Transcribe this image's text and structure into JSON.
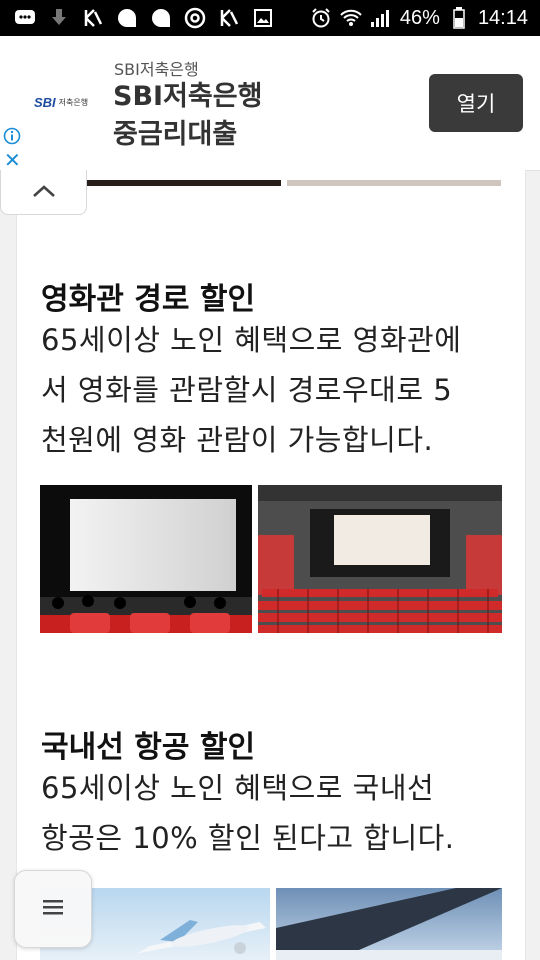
{
  "status_bar": {
    "battery": "46%",
    "time": "14:14"
  },
  "ad": {
    "logo_text": "SBI",
    "logo_sub": "저축은행",
    "subtitle": "SBI저축은행",
    "title_line1": "SBI저축은행",
    "title_line2": "중금리대출",
    "button": "열기"
  },
  "sections": [
    {
      "heading": "영화관 경로 할인",
      "lines": [
        "65세이상 노인 혜택으로 영화관에",
        "서 영화를 관람할시 경로우대로 5",
        "천원에 영화 관람이 가능합니다."
      ]
    },
    {
      "heading": "국내선 항공 할인",
      "lines": [
        "65세이상 노인 혜택으로 국내선",
        "항공은 10% 할인 된다고 합니다."
      ]
    }
  ],
  "icons": {
    "collapse": "chevron-up-icon",
    "menu": "menu-icon",
    "ad_info": "info-icon",
    "ad_close": "close-icon"
  }
}
